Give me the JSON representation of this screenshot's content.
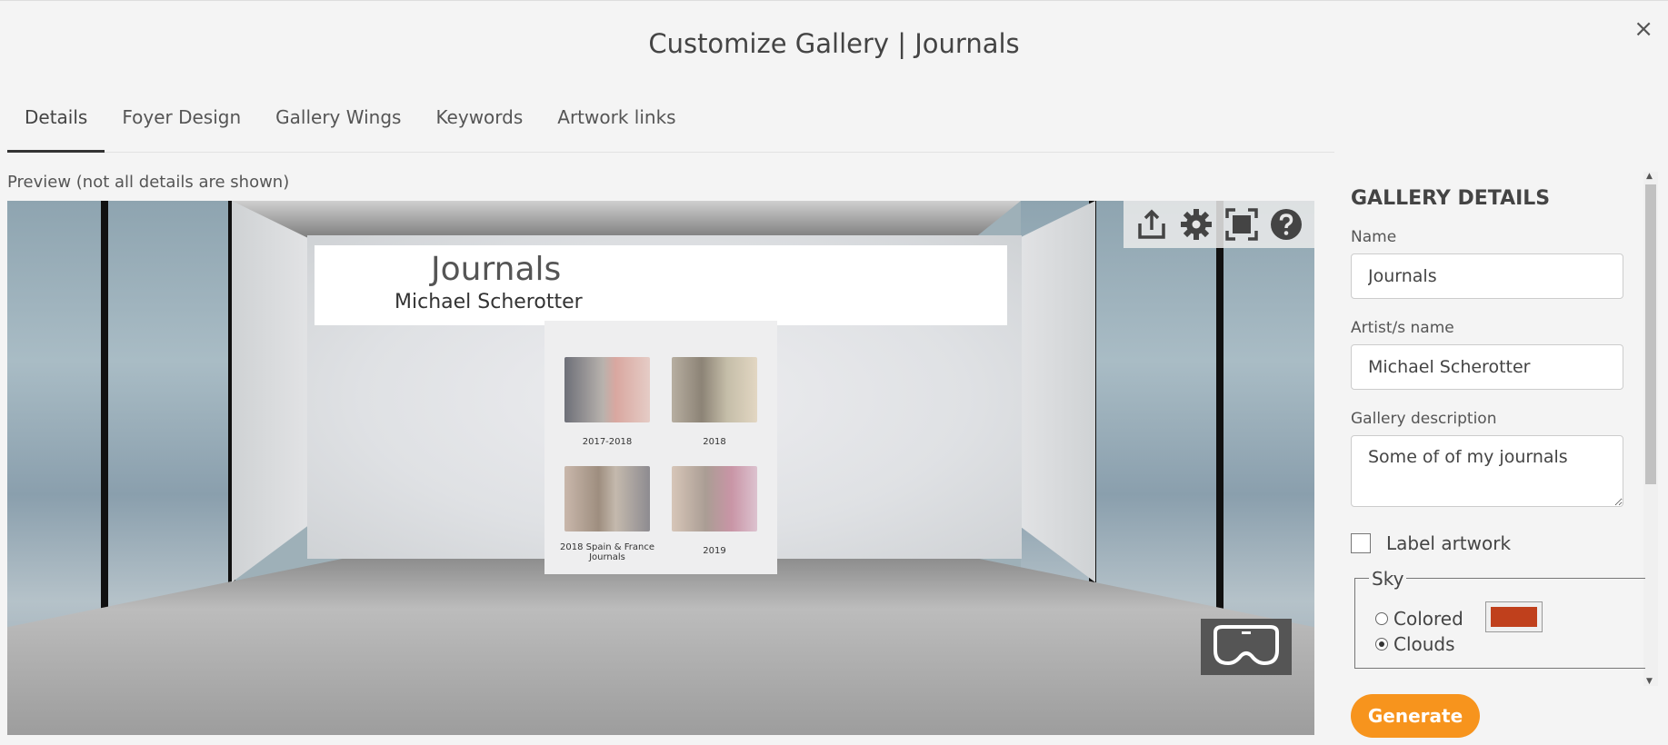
{
  "modal": {
    "title": "Customize Gallery | Journals",
    "close_label": "×"
  },
  "tabs": [
    {
      "label": "Details",
      "active": true
    },
    {
      "label": "Foyer Design",
      "active": false
    },
    {
      "label": "Gallery Wings",
      "active": false
    },
    {
      "label": "Keywords",
      "active": false
    },
    {
      "label": "Artwork links",
      "active": false
    }
  ],
  "preview": {
    "label": "Preview (not all details are shown)",
    "banner_title": "Journals",
    "banner_artist": "Michael Scherotter",
    "artworks": [
      {
        "caption": "2017-2018"
      },
      {
        "caption": "2018"
      },
      {
        "caption": "2018 Spain & France Journals"
      },
      {
        "caption": "2019"
      }
    ],
    "tools": [
      "share-icon",
      "gear-icon",
      "fullscreen-icon",
      "help-icon"
    ],
    "vr_icon": "vr-headset-icon"
  },
  "details": {
    "heading": "GALLERY DETAILS",
    "name_label": "Name",
    "name_value": "Journals",
    "artist_label": "Artist/s name",
    "artist_value": "Michael Scherotter",
    "description_label": "Gallery description",
    "description_value": "Some of of my journals",
    "label_artwork": "Label artwork",
    "label_artwork_checked": false,
    "sky_legend": "Sky",
    "sky_colored": "Colored",
    "sky_clouds": "Clouds",
    "sky_selected": "Clouds",
    "sky_color": "#c0401c"
  },
  "generate_label": "Generate",
  "colors": {
    "accent": "#f7941d",
    "background": "#f4f4f4"
  }
}
